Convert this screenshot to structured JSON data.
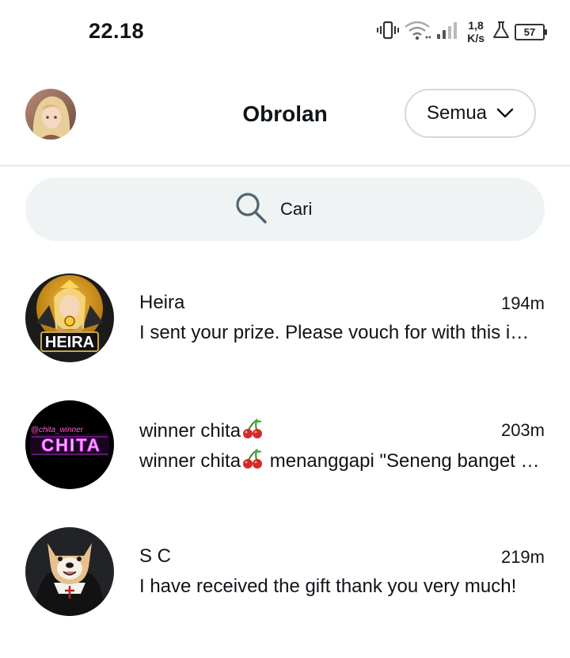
{
  "status_bar": {
    "time": "22.18",
    "net_speed_value": "1,8",
    "net_speed_unit": "K/s",
    "battery_level": "57",
    "battery_fraction": 0.57
  },
  "header": {
    "title": "Obrolan",
    "filter_label": "Semua"
  },
  "search": {
    "placeholder": "Cari"
  },
  "chats": [
    {
      "name": "Heira",
      "time": "194m",
      "preview": "I sent your prize. Please vouch for with this image, thank you"
    },
    {
      "name": "winner chita",
      "time": "203m",
      "preview_name": "winner chita",
      "preview_text": " menanggapi \"Seneng banget bisa menang\""
    },
    {
      "name": "S C",
      "time": "219m",
      "preview": "I have received the gift thank you very much!"
    }
  ],
  "avatar_texts": {
    "heira_logo": "HEIRA",
    "chita_logo": "CHITA",
    "chita_handle": "@chita_winner"
  },
  "colors": {
    "text": "#0f1419",
    "search_bg": "#eff3f4",
    "divider": "#e6e9eb",
    "cherry": "#d42a2a"
  }
}
